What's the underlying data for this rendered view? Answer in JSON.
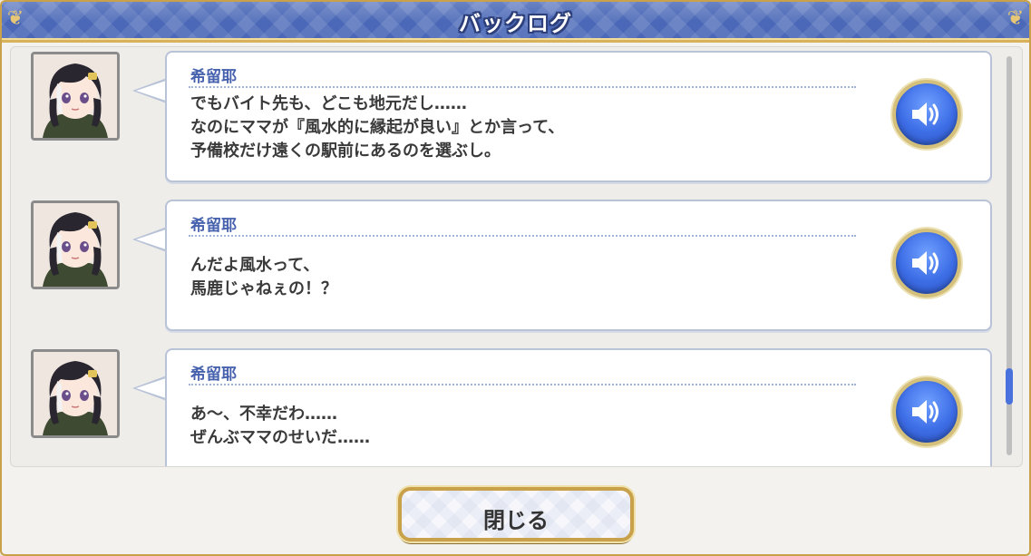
{
  "header": {
    "title": "バックログ"
  },
  "entries": [
    {
      "speaker": "希留耶",
      "text": "でもバイト先も、どこも地元だし……\nなのにママが『風水的に縁起が良い』とか言って、\n予備校だけ遠くの駅前にあるのを選ぶし。",
      "voice_icon": "speaker-icon"
    },
    {
      "speaker": "希留耶",
      "text": "んだよ風水って、\n馬鹿じゃねぇの！？",
      "voice_icon": "speaker-icon"
    },
    {
      "speaker": "希留耶",
      "text": "あ〜、不幸だわ……\nぜんぶママのせいだ……",
      "voice_icon": "speaker-icon"
    }
  ],
  "footer": {
    "close_label": "閉じる"
  },
  "colors": {
    "title_bar": "#4a68b7",
    "gold_border": "#c9a14a",
    "speaker_name": "#4661ad",
    "voice_button": "#3d6de6",
    "scroll_thumb": "#4a72dd"
  }
}
